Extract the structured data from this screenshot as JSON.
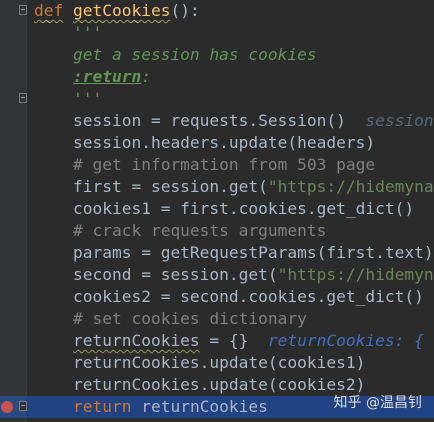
{
  "editor": {
    "lines": [
      {
        "id": "l1",
        "parts": [
          {
            "t": "def",
            "c": "kw squig"
          },
          {
            "t": " ",
            "c": ""
          },
          {
            "t": "getCookies",
            "c": "fn squig"
          },
          {
            "t": "():",
            "c": ""
          }
        ]
      },
      {
        "id": "l2",
        "parts": [
          {
            "t": "    '''",
            "c": "doc"
          }
        ]
      },
      {
        "id": "l3",
        "parts": [
          {
            "t": "    get a session has cookies",
            "c": "doc"
          }
        ]
      },
      {
        "id": "l4",
        "parts": [
          {
            "t": "    ",
            "c": ""
          },
          {
            "t": ":return",
            "c": "doctag"
          },
          {
            "t": ":",
            "c": "doc"
          }
        ]
      },
      {
        "id": "l5",
        "parts": [
          {
            "t": "    '''",
            "c": "doc"
          }
        ]
      },
      {
        "id": "l6",
        "parts": [
          {
            "t": "    session = requests.Session()  ",
            "c": ""
          },
          {
            "t": "session: Session",
            "c": "hint-gray"
          }
        ]
      },
      {
        "id": "l7",
        "parts": [
          {
            "t": "    session.headers.update(headers)",
            "c": ""
          }
        ]
      },
      {
        "id": "l8",
        "parts": [
          {
            "t": "    # get information from 503 page",
            "c": "cm"
          }
        ]
      },
      {
        "id": "l9",
        "parts": [
          {
            "t": "    first = session.get(",
            "c": ""
          },
          {
            "t": "\"https://hidemyna",
            "c": "str"
          }
        ]
      },
      {
        "id": "l10",
        "parts": [
          {
            "t": "    cookies1 = first.cookies.get_dict()",
            "c": ""
          }
        ]
      },
      {
        "id": "l11",
        "parts": [
          {
            "t": "    # crack requests arguments",
            "c": "cm"
          }
        ]
      },
      {
        "id": "l12",
        "parts": [
          {
            "t": "    params = getRequestParams(first.text)",
            "c": ""
          }
        ]
      },
      {
        "id": "l13",
        "parts": [
          {
            "t": "    second = session.get(",
            "c": ""
          },
          {
            "t": "\"https://hidemyn",
            "c": "str"
          }
        ]
      },
      {
        "id": "l14",
        "parts": [
          {
            "t": "    cookies2 = second.cookies.get_dict()",
            "c": ""
          }
        ]
      },
      {
        "id": "l15",
        "parts": [
          {
            "t": "    # set cookies dictionary",
            "c": "cm"
          }
        ]
      },
      {
        "id": "l16",
        "parts": [
          {
            "t": "    ",
            "c": ""
          },
          {
            "t": "returnCookies",
            "c": "squig"
          },
          {
            "t": " = {}  ",
            "c": ""
          },
          {
            "t": "returnCookies: {",
            "c": "hint"
          }
        ]
      },
      {
        "id": "l17",
        "parts": [
          {
            "t": "    returnCookies.update(cookies1)",
            "c": ""
          }
        ]
      },
      {
        "id": "l18",
        "parts": [
          {
            "t": "    returnCookies.update(cookies2)",
            "c": ""
          }
        ]
      },
      {
        "id": "l19",
        "parts": [
          {
            "t": "    ",
            "c": ""
          },
          {
            "t": "return",
            "c": "kw"
          },
          {
            "t": " returnCookies",
            "c": ""
          }
        ]
      }
    ]
  },
  "watermark": "知乎 @温昌钊"
}
